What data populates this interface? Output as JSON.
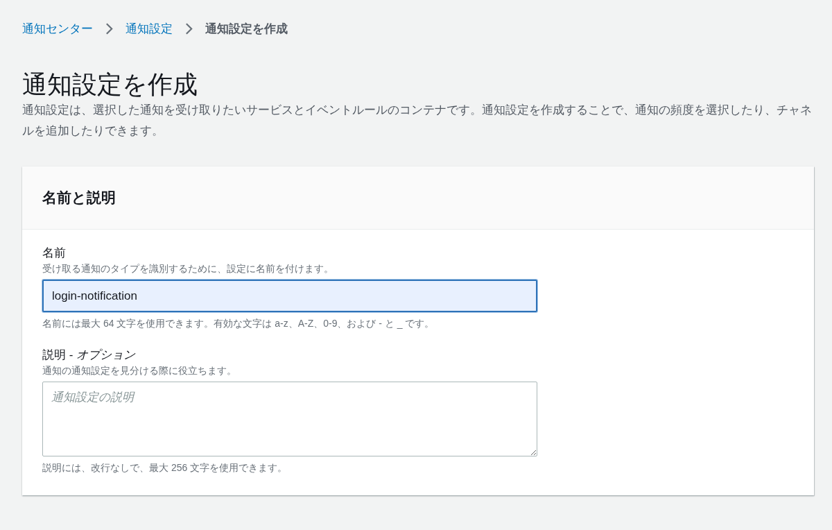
{
  "breadcrumb": [
    {
      "label": "通知センター",
      "current": false
    },
    {
      "label": "通知設定",
      "current": false
    },
    {
      "label": "通知設定を作成",
      "current": true
    }
  ],
  "page": {
    "title": "通知設定を作成",
    "description": "通知設定は、選択した通知を受け取りたいサービスとイベントルールのコンテナです。通知設定を作成することで、通知の頻度を選択したり、チャネルを追加したりできます。"
  },
  "panel": {
    "title": "名前と説明",
    "fields": [
      {
        "kind": "input",
        "label": "名前",
        "description": "受け取る通知のタイプを識別するために、設定に名前を付けます。",
        "value": "login-notification",
        "focused": true,
        "constraint": "名前には最大 64 文字を使用できます。有効な文字は a-z、A-Z、0-9、および - と _ です。"
      },
      {
        "kind": "textarea",
        "label": "説明 - *オプション*",
        "description": "通知の通知設定を見分ける際に役立ちます。",
        "placeholder": "通知設定の説明",
        "focused": false,
        "constraint": "説明には、改行なしで、最大 256 文字を使用できます。"
      }
    ]
  }
}
